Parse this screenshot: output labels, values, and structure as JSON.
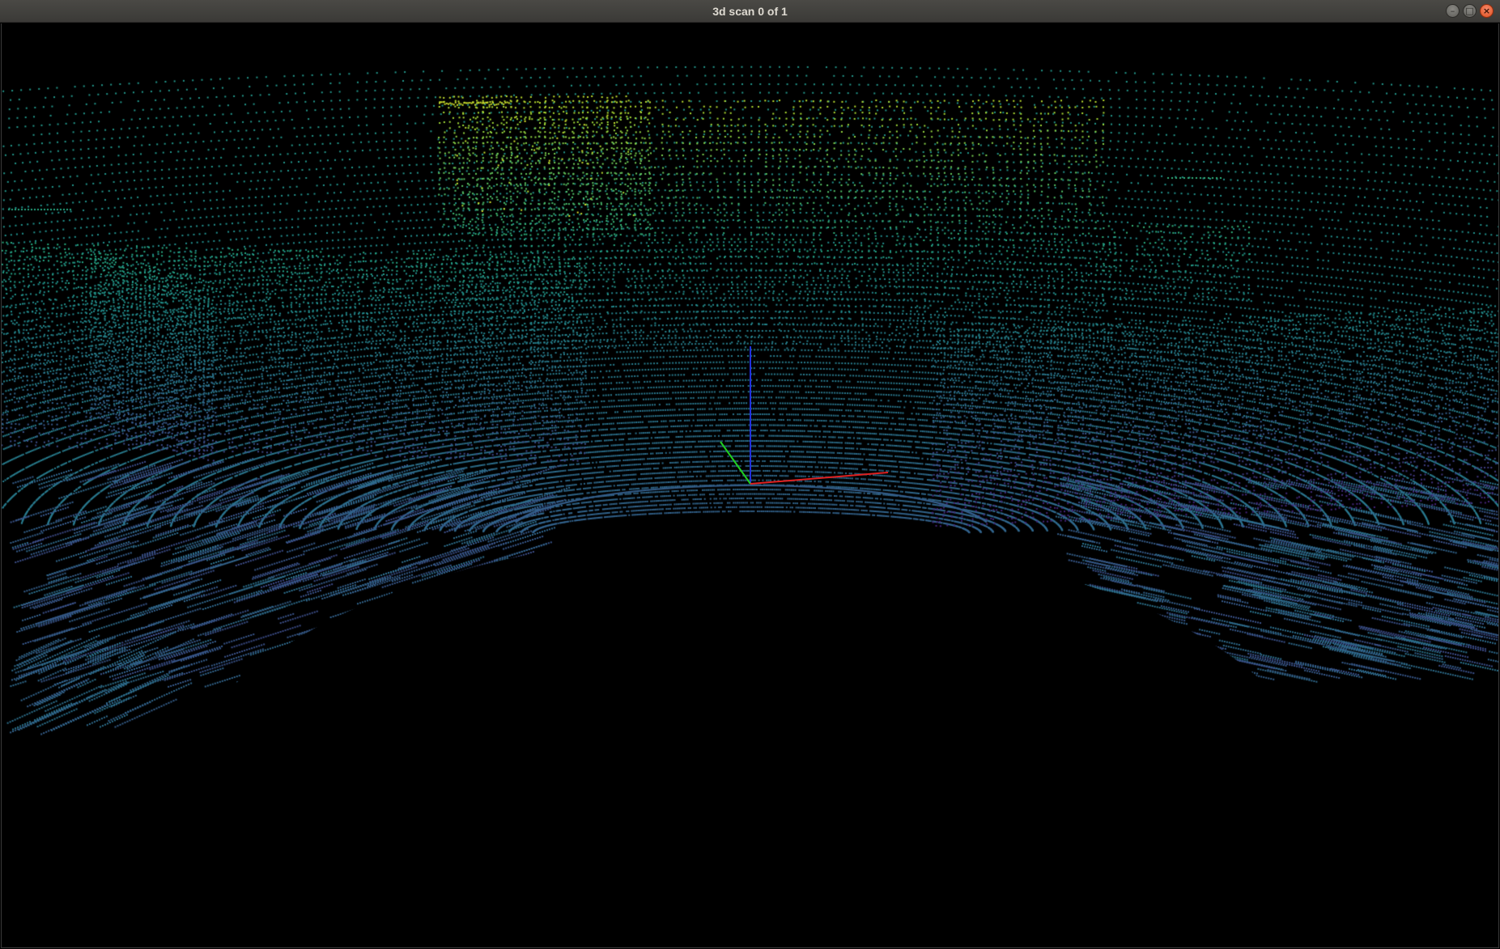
{
  "window": {
    "title": "3d scan 0 of 1"
  },
  "controls": {
    "minimize_glyph": "–",
    "maximize_glyph": "□",
    "close_glyph": "×"
  },
  "icons": {
    "minimize": "minimize-icon",
    "maximize": "maximize-icon",
    "close": "close-icon"
  },
  "colors": {
    "background": "#000000",
    "axis_x": "#e02020",
    "axis_y": "#20d020",
    "axis_z": "#2030e0",
    "colormap": [
      "#46247a",
      "#3b528b",
      "#2c728e",
      "#21908d",
      "#27ad81",
      "#5dc863",
      "#aadc32",
      "#fde725"
    ]
  },
  "scene": {
    "type": "point-cloud",
    "colormap": "viridis (by height)"
  }
}
